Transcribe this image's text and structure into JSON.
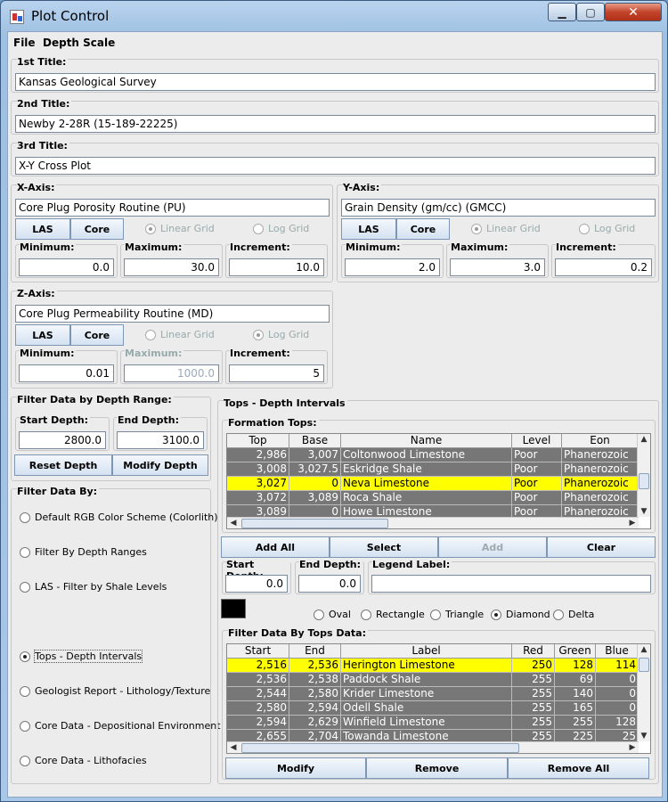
{
  "window": {
    "title": "Plot Control"
  },
  "menu": [
    "File",
    "Depth Scale"
  ],
  "titles": {
    "first_label": "1st Title:",
    "first_value": "Kansas Geological Survey",
    "second_label": "2nd Title:",
    "second_value": "Newby 2-28R (15-189-22225)",
    "third_label": "3rd Title:",
    "third_value": "X-Y Cross Plot"
  },
  "x_axis": {
    "label": "X-Axis:",
    "name": "Core Plug Porosity Routine (PU)",
    "las": "LAS",
    "core": "Core",
    "linear": "Linear Grid",
    "log": "Log Grid",
    "min_label": "Minimum:",
    "min": "0.0",
    "max_label": "Maximum:",
    "max": "30.0",
    "inc_label": "Increment:",
    "inc": "10.0"
  },
  "y_axis": {
    "label": "Y-Axis:",
    "name": "Grain Density (gm/cc) (GMCC)",
    "las": "LAS",
    "core": "Core",
    "linear": "Linear Grid",
    "log": "Log Grid",
    "min_label": "Minimum:",
    "min": "2.0",
    "max_label": "Maximum:",
    "max": "3.0",
    "inc_label": "Increment:",
    "inc": "0.2"
  },
  "z_axis": {
    "label": "Z-Axis:",
    "name": "Core Plug Permeability Routine (MD)",
    "las": "LAS",
    "core": "Core",
    "linear": "Linear Grid",
    "log": "Log Grid",
    "min_label": "Minimum:",
    "min": "0.01",
    "max_label": "Maximum:",
    "max": "1000.0",
    "inc_label": "Increment:",
    "inc": "5"
  },
  "depth_filter": {
    "label": "Filter Data by Depth Range:",
    "start_label": "Start Depth:",
    "start": "2800.0",
    "end_label": "End Depth:",
    "end": "3100.0",
    "reset": "Reset Depth",
    "modify": "Modify Depth"
  },
  "filter_by": {
    "label": "Filter Data By:",
    "options": [
      "Default RGB Color Scheme (Colorlith)",
      "Filter By Depth Ranges",
      "LAS - Filter by Shale Levels",
      "Tops - Depth Intervals",
      "Geologist Report - Lithology/Texture",
      "Core Data - Depositional Environment",
      "Core Data - Lithofacies"
    ],
    "selected": 3
  },
  "tops": {
    "label": "Tops - Depth Intervals",
    "formation_label": "Formation Tops:",
    "columns": [
      "Top",
      "Base",
      "Name",
      "Level",
      "Eon"
    ],
    "rows": [
      [
        "2,986",
        "3,007",
        "Coltonwood Limestone",
        "Poor",
        "Phanerozoic"
      ],
      [
        "3,008",
        "3,027.5",
        "Eskridge Shale",
        "Poor",
        "Phanerozoic"
      ],
      [
        "3,027",
        "0",
        "Neva Limestone",
        "Poor",
        "Phanerozoic"
      ],
      [
        "3,072",
        "3,089",
        "Roca Shale",
        "Poor",
        "Phanerozoic"
      ],
      [
        "3,089",
        "0",
        "Howe Limestone",
        "Poor",
        "Phanerozoic"
      ]
    ],
    "selected_row": 2,
    "add_all": "Add All",
    "select": "Select",
    "add": "Add",
    "clear": "Clear",
    "start_label": "Start Depth:",
    "start": "0.0",
    "end_label": "End Depth:",
    "end": "0.0",
    "legend_label": "Legend Label:",
    "legend_value": "",
    "symbols": [
      "Oval",
      "Rectangle",
      "Triangle",
      "Diamond",
      "Delta"
    ],
    "symbol_selected": 3,
    "symbol_color": "#000000",
    "data_label": "Filter Data By Tops Data:",
    "data_columns": [
      "Start",
      "End",
      "Label",
      "Red",
      "Green",
      "Blue"
    ],
    "data_rows": [
      [
        "2,516",
        "2,536",
        "Herington Limestone",
        "250",
        "128",
        "114"
      ],
      [
        "2,536",
        "2,538",
        "Paddock Shale",
        "255",
        "69",
        "0"
      ],
      [
        "2,544",
        "2,580",
        "Krider Limestone",
        "255",
        "140",
        "0"
      ],
      [
        "2,580",
        "2,594",
        "Odell Shale",
        "255",
        "165",
        "0"
      ],
      [
        "2,594",
        "2,629",
        "Winfield Limestone",
        "255",
        "255",
        "128"
      ],
      [
        "2,655",
        "2,704",
        "Towanda Limestone",
        "255",
        "225",
        "25"
      ]
    ],
    "data_selected_row": 0,
    "modify": "Modify",
    "remove": "Remove",
    "remove_all": "Remove All"
  },
  "colors": {
    "row_bg": "#777777",
    "row_selected": "#ffff00"
  }
}
